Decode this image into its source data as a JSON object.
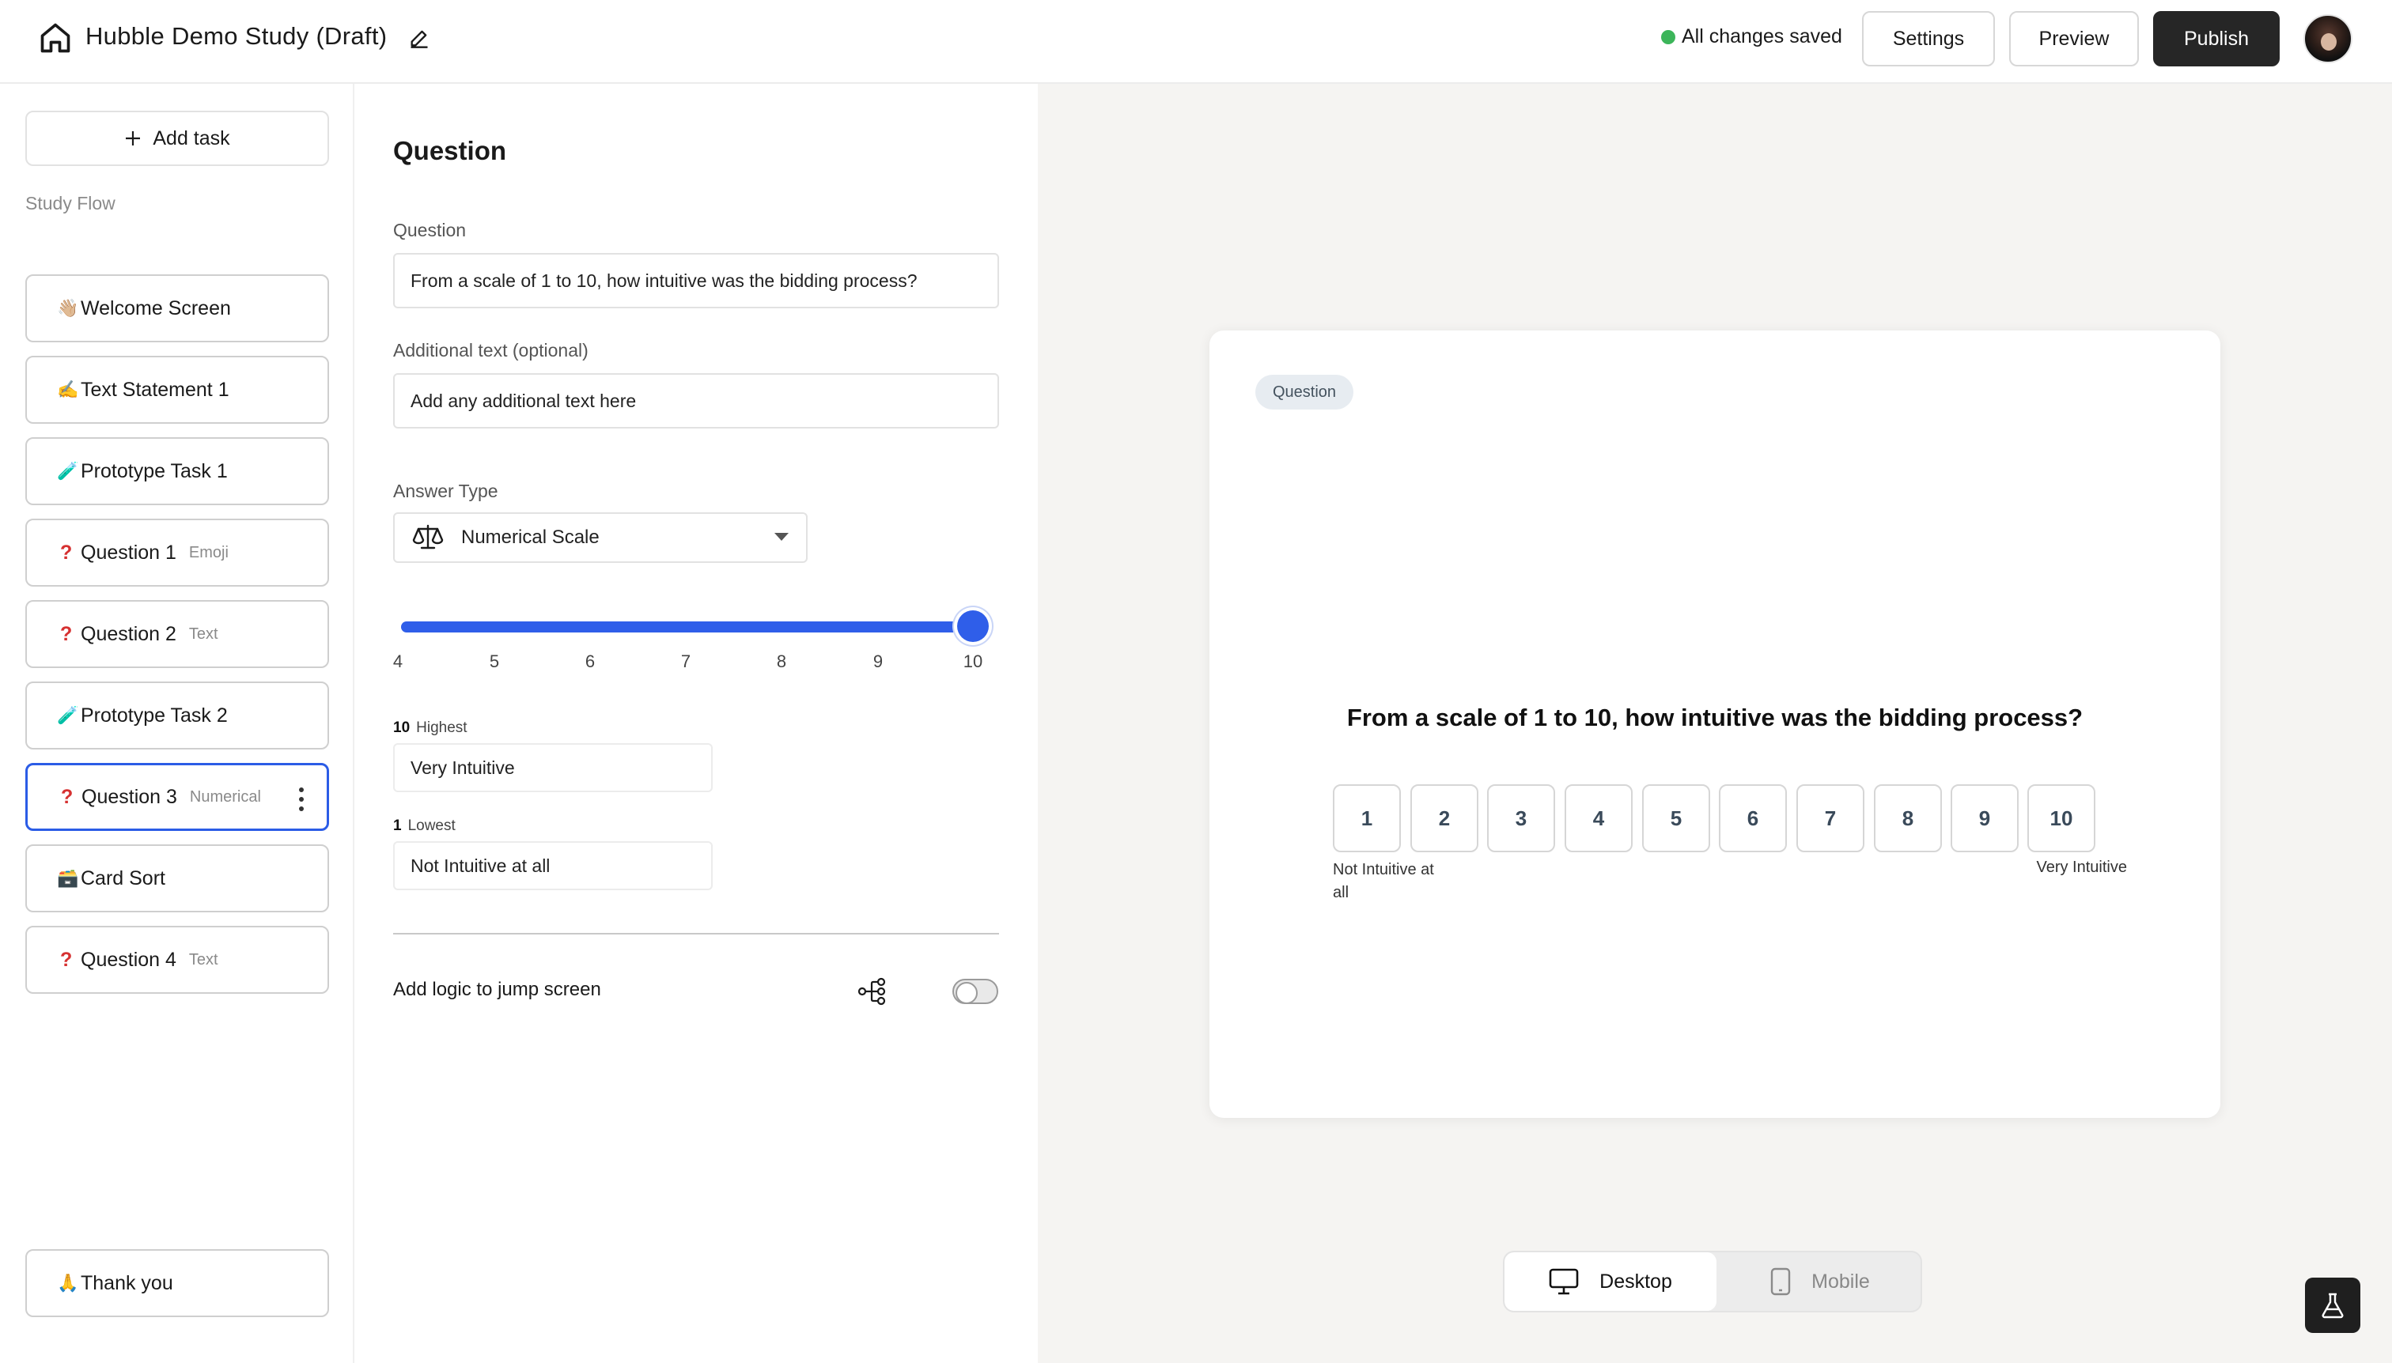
{
  "header": {
    "title": "Hubble Demo Study (Draft)",
    "save_status": "All changes saved",
    "save_status_color": "#3cb55a",
    "settings_label": "Settings",
    "preview_label": "Preview",
    "publish_label": "Publish"
  },
  "sidebar": {
    "add_task_label": "Add task",
    "section_label": "Study Flow",
    "items": [
      {
        "emoji": "👋🏼",
        "label": "Welcome Screen",
        "tag": ""
      },
      {
        "emoji": "✍️",
        "label": "Text Statement 1",
        "tag": ""
      },
      {
        "emoji": "🧪",
        "label": "Prototype Task 1",
        "tag": ""
      },
      {
        "emoji": "❓",
        "label": "Question 1",
        "tag": "Emoji"
      },
      {
        "emoji": "❓",
        "label": "Question 2",
        "tag": "Text"
      },
      {
        "emoji": "🧪",
        "label": "Prototype Task 2",
        "tag": ""
      },
      {
        "emoji": "❓",
        "label": "Question 3",
        "tag": "Numerical",
        "selected": true
      },
      {
        "emoji": "🗃️",
        "label": "Card Sort",
        "tag": ""
      },
      {
        "emoji": "❓",
        "label": "Question 4",
        "tag": "Text"
      }
    ],
    "thank_you": {
      "emoji": "🙏",
      "label": "Thank you"
    }
  },
  "editor": {
    "title": "Question",
    "question_label": "Question",
    "question_value": "From a scale of 1 to 10, how intuitive was the bidding process?",
    "additional_label": "Additional text (optional)",
    "additional_placeholder": "Add any additional text here",
    "answer_type_label": "Answer Type",
    "answer_type_value": "Numerical Scale",
    "slider": {
      "min": 4,
      "max": 10,
      "value": 10,
      "ticks": [
        "4",
        "5",
        "6",
        "7",
        "8",
        "9",
        "10"
      ]
    },
    "highest": {
      "value": "10",
      "label": "Highest",
      "text": "Very Intuitive"
    },
    "lowest": {
      "value": "1",
      "label": "Lowest",
      "text": "Not Intuitive at all"
    },
    "logic_label": "Add logic to jump screen",
    "logic_enabled": false
  },
  "preview": {
    "badge": "Question",
    "question": "From a scale of 1 to 10, how intuitive was the bidding process?",
    "scale": [
      "1",
      "2",
      "3",
      "4",
      "5",
      "6",
      "7",
      "8",
      "9",
      "10"
    ],
    "low_label": "Not Intuitive at all",
    "high_label": "Very Intuitive",
    "device_desktop": "Desktop",
    "device_mobile": "Mobile",
    "active_device": "Desktop"
  },
  "colors": {
    "accent": "#2f5ee9",
    "publish_bg": "#262626",
    "question_mark": "#d63131"
  }
}
